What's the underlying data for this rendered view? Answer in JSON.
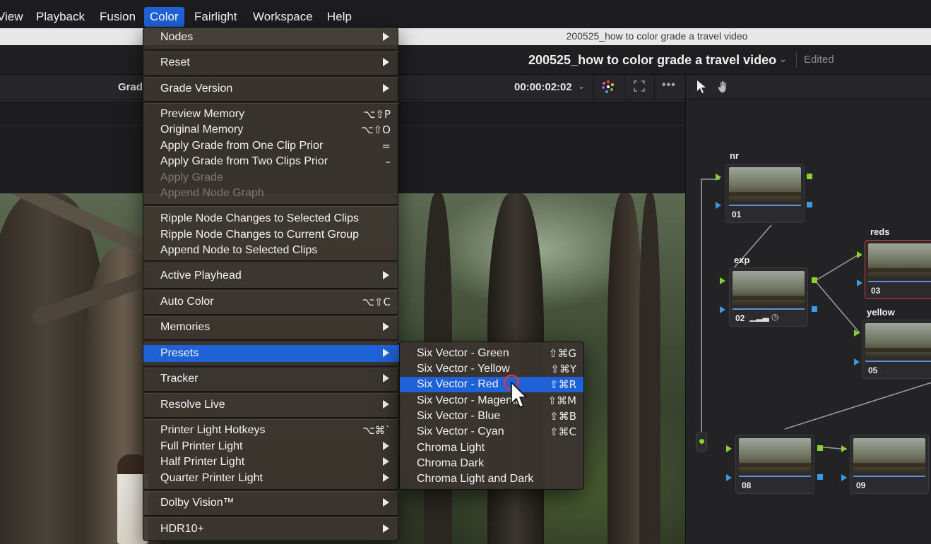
{
  "menubar": {
    "items": [
      {
        "label": "View"
      },
      {
        "label": "Playback"
      },
      {
        "label": "Fusion"
      },
      {
        "label": "Color"
      },
      {
        "label": "Fairlight"
      },
      {
        "label": "Workspace"
      },
      {
        "label": "Help"
      }
    ]
  },
  "window": {
    "title": "200525_how to color grade a travel video"
  },
  "project": {
    "name": "200525_how to color grade a travel video",
    "status": "Edited"
  },
  "viewer_toolbar": {
    "partial_label": "Grad",
    "timecode": "00:00:02:02"
  },
  "color_menu": {
    "items": [
      {
        "label": "Nodes",
        "submenu": true
      },
      {
        "label": "Reset",
        "submenu": true
      },
      {
        "label": "Grade Version",
        "submenu": true
      },
      {
        "label": "Preview Memory",
        "shortcut": "⌥⇧P"
      },
      {
        "label": "Original Memory",
        "shortcut": "⌥⇧O"
      },
      {
        "label": "Apply Grade from One Clip Prior",
        "shortcut": "="
      },
      {
        "label": "Apply Grade from Two Clips Prior",
        "shortcut": "–"
      },
      {
        "label": "Apply Grade",
        "disabled": true
      },
      {
        "label": "Append Node Graph",
        "disabled": true
      },
      {
        "label": "Ripple Node Changes to Selected Clips"
      },
      {
        "label": "Ripple Node Changes to Current Group"
      },
      {
        "label": "Append Node to Selected Clips"
      },
      {
        "label": "Active Playhead",
        "submenu": true
      },
      {
        "label": "Auto Color",
        "shortcut": "⌥⇧C"
      },
      {
        "label": "Memories",
        "submenu": true
      },
      {
        "label": "Presets",
        "submenu": true,
        "highlighted": true
      },
      {
        "label": "Tracker",
        "submenu": true
      },
      {
        "label": "Resolve Live",
        "submenu": true
      },
      {
        "label": "Printer Light Hotkeys",
        "shortcut": "⌥⌘`"
      },
      {
        "label": "Full Printer Light",
        "submenu": true
      },
      {
        "label": "Half Printer Light",
        "submenu": true
      },
      {
        "label": "Quarter Printer Light",
        "submenu": true
      },
      {
        "label": "Dolby Vision™",
        "submenu": true
      },
      {
        "label": "HDR10+",
        "submenu": true
      }
    ]
  },
  "presets_menu": {
    "items": [
      {
        "label": "Six Vector - Green",
        "shortcut": "⇧⌘G"
      },
      {
        "label": "Six Vector - Yellow",
        "shortcut": "⇧⌘Y"
      },
      {
        "label": "Six Vector - Red",
        "shortcut": "⇧⌘R",
        "highlighted": true
      },
      {
        "label": "Six Vector - Magenta",
        "shortcut": "⇧⌘M"
      },
      {
        "label": "Six Vector - Blue",
        "shortcut": "⇧⌘B"
      },
      {
        "label": "Six Vector - Cyan",
        "shortcut": "⇧⌘C"
      },
      {
        "label": "Chroma Light"
      },
      {
        "label": "Chroma Dark"
      },
      {
        "label": "Chroma Light and Dark"
      }
    ]
  },
  "nodes": [
    {
      "label": "nr",
      "number": "01"
    },
    {
      "label": "exp",
      "number": "02"
    },
    {
      "label": "reds",
      "number": "03"
    },
    {
      "label": "yellow",
      "number": "05"
    },
    {
      "label": "",
      "number": "08"
    },
    {
      "label": "",
      "number": "09"
    }
  ],
  "icons": {
    "color_wheel": "color-wheel-icon",
    "fullscreen": "expand-icon",
    "more": "ellipsis-icon",
    "pointer": "pointer-tool-icon",
    "hand": "hand-tool-icon",
    "node_tools": "node-tools-icon",
    "node_clock": "clock-icon"
  },
  "colors": {
    "menu_highlight": "#1f62d8",
    "node_port_green": "#8ccf2e",
    "node_port_blue": "#3a9be0",
    "selected_node_border": "#c8413a"
  }
}
